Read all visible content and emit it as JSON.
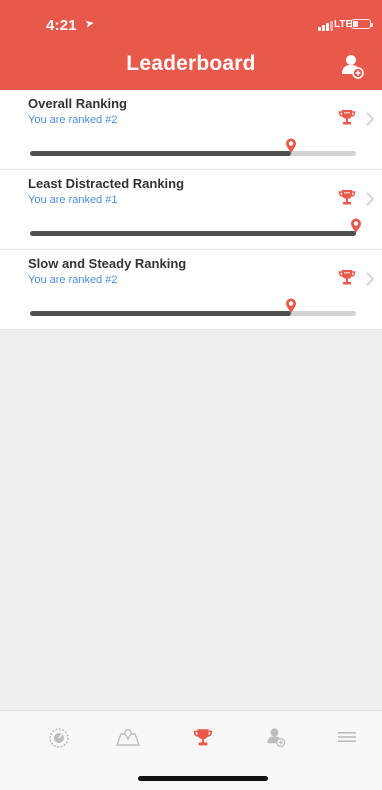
{
  "status_bar": {
    "time": "4:21",
    "carrier": "LTE",
    "battery_level": 0.3
  },
  "header": {
    "title": "Leaderboard",
    "add_user_icon": "add-user-icon",
    "background_color": "#e8594b"
  },
  "rankings": [
    {
      "title": "Overall Ranking",
      "subtitle": "You are ranked #2",
      "progress": 0.8,
      "icon": "trophy-icon"
    },
    {
      "title": "Least Distracted Ranking",
      "subtitle": "You are ranked #1",
      "progress": 1.0,
      "icon": "trophy-icon"
    },
    {
      "title": "Slow and Steady Ranking",
      "subtitle": "You are ranked #2",
      "progress": 0.8,
      "icon": "trophy-icon"
    }
  ],
  "tabbar": {
    "tabs": [
      {
        "icon": "speedometer-icon",
        "active": false
      },
      {
        "icon": "map-icon",
        "active": false
      },
      {
        "icon": "trophy-icon",
        "active": true
      },
      {
        "icon": "add-user-icon",
        "active": false
      },
      {
        "icon": "menu-icon",
        "active": false
      }
    ],
    "active_color": "#e8594b",
    "inactive_color": "#bdbdbd"
  }
}
